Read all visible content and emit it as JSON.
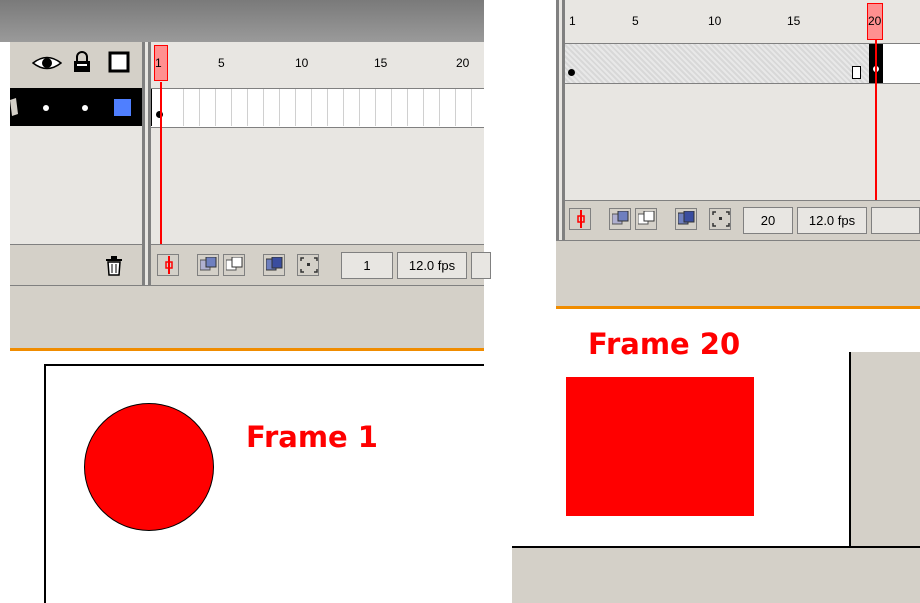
{
  "left_panel": {
    "ruler_numbers": [
      "1",
      "5",
      "10",
      "15",
      "20"
    ],
    "current_frame": "1",
    "frame_rate": "12.0 fps",
    "stage_label": "Frame 1"
  },
  "right_panel": {
    "ruler_numbers": [
      "1",
      "5",
      "10",
      "15",
      "20"
    ],
    "current_frame": "20",
    "frame_rate": "12.0 fps",
    "stage_label": "Frame 20"
  },
  "colors": {
    "accent_red": "#ff0000",
    "timeline_bg": "#e8e6e2",
    "panel_gray": "#d4d0c8",
    "orange_divider": "#f08c00",
    "layer_color_square": "#4f7fff"
  },
  "icons": [
    "eye-icon",
    "lock-icon",
    "outline-icon",
    "pencil-icon",
    "trash-icon",
    "center-frame-icon",
    "onion-skin-icon",
    "onion-skin-outlines-icon",
    "edit-multiple-frames-icon",
    "modify-onion-markers-icon"
  ]
}
